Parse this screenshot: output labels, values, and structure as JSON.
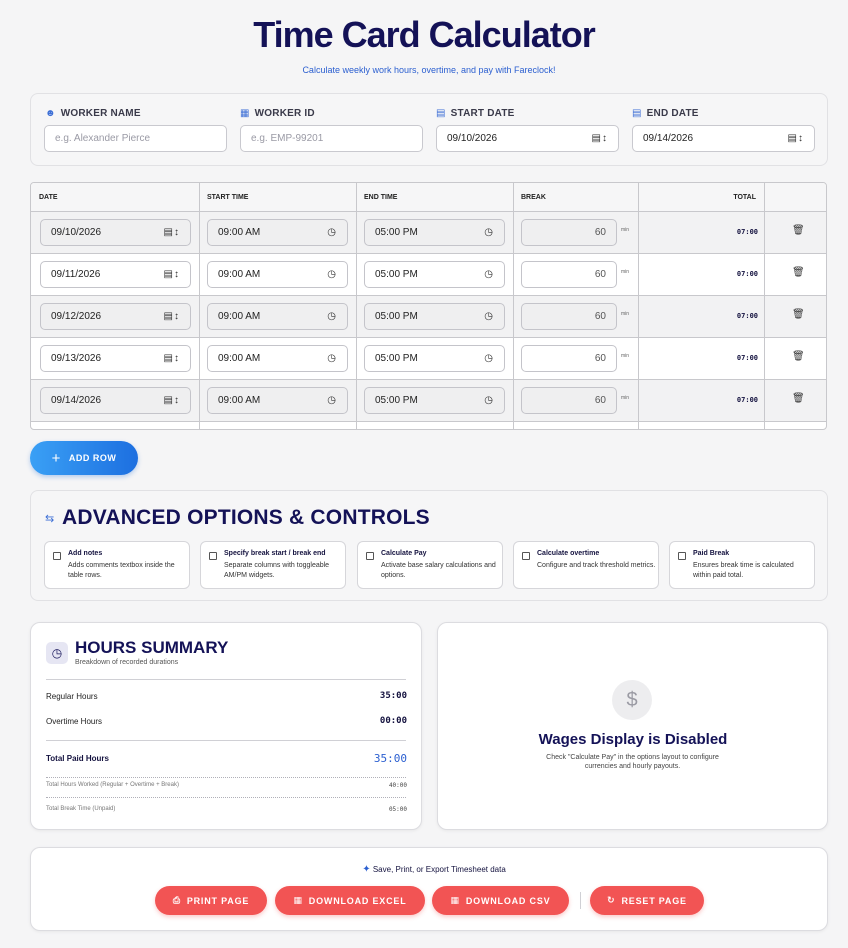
{
  "header": {
    "title": "Time Card Calculator",
    "subtitle": "Calculate weekly work hours, overtime, and pay with Fareclock!"
  },
  "worker_fields": {
    "worker_name": {
      "label": "WORKER NAME",
      "placeholder": "e.g. Alexander Pierce",
      "icon": "user-icon"
    },
    "worker_id": {
      "label": "WORKER ID",
      "placeholder": "e.g. EMP-99201",
      "icon": "id-card-icon"
    },
    "start_date": {
      "label": "START DATE",
      "value": "09/10/2026",
      "icon": "calendar-icon"
    },
    "end_date": {
      "label": "END DATE",
      "value": "09/14/2026",
      "icon": "calendar-icon"
    }
  },
  "table": {
    "headers": {
      "date": "DATE",
      "start": "START TIME",
      "end": "END TIME",
      "break": "BREAK",
      "total": "TOTAL"
    },
    "break_unit": "min",
    "rows": [
      {
        "date": "09/10/2026",
        "start": "09:00 AM",
        "end": "05:00 PM",
        "break": "60",
        "total": "07:00"
      },
      {
        "date": "09/11/2026",
        "start": "09:00 AM",
        "end": "05:00 PM",
        "break": "60",
        "total": "07:00"
      },
      {
        "date": "09/12/2026",
        "start": "09:00 AM",
        "end": "05:00 PM",
        "break": "60",
        "total": "07:00"
      },
      {
        "date": "09/13/2026",
        "start": "09:00 AM",
        "end": "05:00 PM",
        "break": "60",
        "total": "07:00"
      },
      {
        "date": "09/14/2026",
        "start": "09:00 AM",
        "end": "05:00 PM",
        "break": "60",
        "total": "07:00"
      }
    ]
  },
  "add_row_label": "ADD ROW",
  "advanced": {
    "title": "ADVANCED OPTIONS & CONTROLS",
    "options": [
      {
        "title": "Add notes",
        "desc": "Adds comments textbox inside the table rows.",
        "checked": false
      },
      {
        "title": "Specify break start / break end",
        "desc": "Separate columns with toggleable AM/PM widgets.",
        "checked": false
      },
      {
        "title": "Calculate Pay",
        "desc": "Activate base salary calculations and options.",
        "checked": false
      },
      {
        "title": "Calculate overtime",
        "desc": "Configure and track threshold metrics.",
        "checked": false
      },
      {
        "title": "Paid Break",
        "desc": "Ensures break time is calculated within paid total.",
        "checked": false
      }
    ]
  },
  "summary": {
    "title": "HOURS SUMMARY",
    "subtitle": "Breakdown of recorded durations",
    "regular_label": "Regular Hours",
    "regular_value": "35:00",
    "overtime_label": "Overtime Hours",
    "overtime_value": "00:00",
    "total_paid_label": "Total Paid Hours",
    "total_paid_value": "35:00",
    "total_worked_label": "Total Hours Worked (Regular + Overtime + Break)",
    "total_worked_value": "40:00",
    "total_break_label": "Total Break Time (Unpaid)",
    "total_break_value": "05:00"
  },
  "wages": {
    "title": "Wages Display is Disabled",
    "desc": "Check \"Calculate Pay\" in the options layout to configure currencies and hourly payouts."
  },
  "export": {
    "label": "Save, Print, or Export Timesheet data",
    "print": "PRINT PAGE",
    "excel": "DOWNLOAD EXCEL",
    "csv": "DOWNLOAD CSV",
    "reset": "RESET PAGE"
  },
  "colors": {
    "navy": "#141257",
    "accent_blue": "#1d6fe0",
    "action_red": "#f25454"
  }
}
